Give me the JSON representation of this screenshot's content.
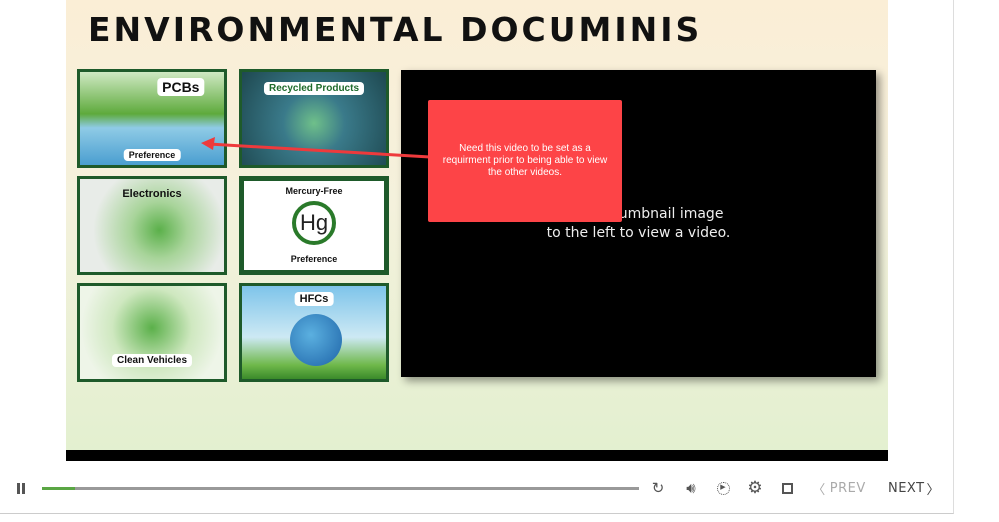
{
  "slide": {
    "title": "ENVIRONMENTAL DOCUMINIS",
    "thumbnails": [
      {
        "label": "PCBs",
        "sublabel": "Preference"
      },
      {
        "label": "Recycled Products"
      },
      {
        "label": "Electronics"
      },
      {
        "label": "Mercury-Free",
        "symbol": "Hg",
        "sublabel": "Preference"
      },
      {
        "label": "Clean Vehicles"
      },
      {
        "label": "HFCs"
      }
    ],
    "video_prompt_line1": "Click a thumbnail image",
    "video_prompt_line2": "to the left to view a video.",
    "callout_text": "Need this video to be set as a requirment prior to being able to view the other videos."
  },
  "player": {
    "progress_percent": 5.5,
    "prev_label": "PREV",
    "next_label": "NEXT",
    "accent": "#5aa644"
  }
}
